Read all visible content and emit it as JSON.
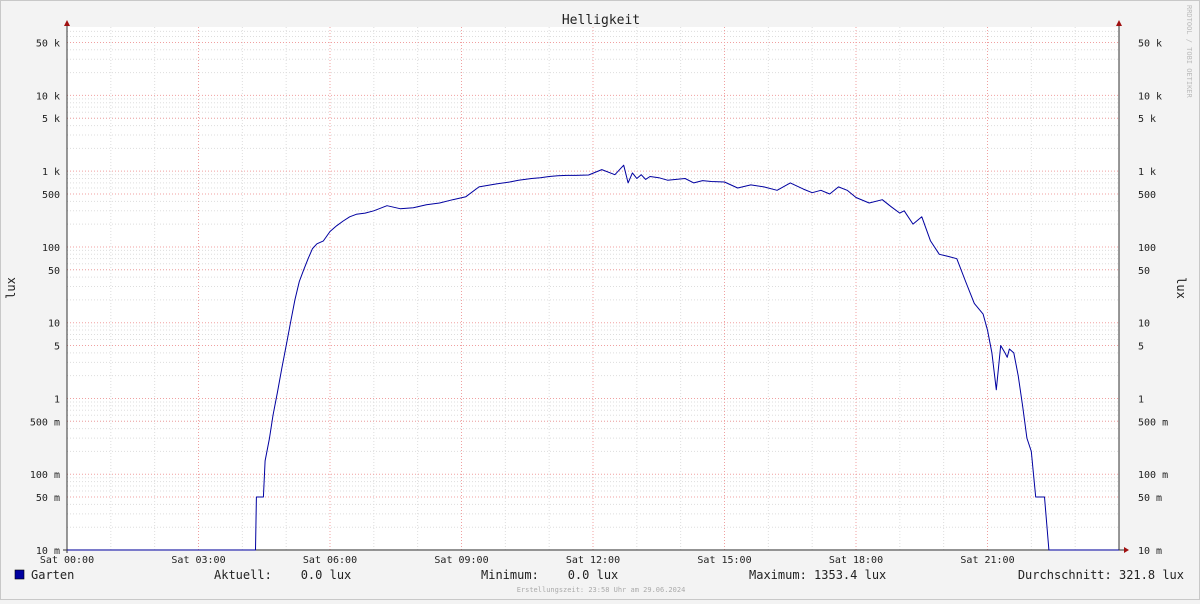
{
  "chart_data": {
    "type": "line",
    "title": "Helligkeit",
    "ylabel": "lux",
    "yscale": "log",
    "ylim": [
      0.01,
      80000
    ],
    "xlim": [
      0,
      24
    ],
    "x_ticks": [
      "Sat 00:00",
      "Sat 03:00",
      "Sat 06:00",
      "Sat 09:00",
      "Sat 12:00",
      "Sat 15:00",
      "Sat 18:00",
      "Sat 21:00"
    ],
    "y_ticks": [
      {
        "value": 0.01,
        "label": "10 m"
      },
      {
        "value": 0.05,
        "label": "50 m"
      },
      {
        "value": 0.1,
        "label": "100 m"
      },
      {
        "value": 0.5,
        "label": "500 m"
      },
      {
        "value": 1,
        "label": "1"
      },
      {
        "value": 5,
        "label": "5"
      },
      {
        "value": 10,
        "label": "10"
      },
      {
        "value": 50,
        "label": "50"
      },
      {
        "value": 100,
        "label": "100"
      },
      {
        "value": 500,
        "label": "500"
      },
      {
        "value": 1000,
        "label": "1 k"
      },
      {
        "value": 5000,
        "label": "5 k"
      },
      {
        "value": 10000,
        "label": "10 k"
      },
      {
        "value": 50000,
        "label": "50 k"
      }
    ],
    "grid": true,
    "series": [
      {
        "name": "Garten",
        "color": "#0000a0",
        "x": [
          0,
          4.3,
          4.32,
          4.48,
          4.52,
          4.62,
          4.7,
          4.8,
          4.9,
          5.0,
          5.1,
          5.2,
          5.3,
          5.4,
          5.5,
          5.6,
          5.7,
          5.85,
          6.0,
          6.15,
          6.3,
          6.45,
          6.6,
          6.8,
          7.0,
          7.3,
          7.6,
          7.9,
          8.2,
          8.5,
          8.8,
          9.1,
          9.4,
          9.8,
          10.1,
          10.3,
          10.6,
          10.8,
          11.0,
          11.2,
          11.4,
          11.6,
          11.9,
          12.2,
          12.5,
          12.7,
          12.8,
          12.9,
          13.0,
          13.1,
          13.2,
          13.3,
          13.5,
          13.7,
          13.9,
          14.1,
          14.3,
          14.5,
          14.7,
          15.0,
          15.3,
          15.6,
          15.9,
          16.2,
          16.5,
          16.8,
          17.0,
          17.2,
          17.4,
          17.6,
          17.8,
          18.0,
          18.3,
          18.6,
          18.8,
          19.0,
          19.1,
          19.3,
          19.5,
          19.7,
          19.9,
          20.1,
          20.3,
          20.5,
          20.7,
          20.9,
          21.0,
          21.1,
          21.2,
          21.3,
          21.4,
          21.45,
          21.5,
          21.6,
          21.7,
          21.8,
          21.9,
          22.0,
          22.1,
          22.2,
          22.3,
          22.4,
          22.5,
          22.6,
          22.7,
          22.75,
          24
        ],
        "values": [
          0.01,
          0.01,
          0.05,
          0.05,
          0.15,
          0.3,
          0.6,
          1.2,
          2.5,
          5,
          10,
          20,
          35,
          50,
          70,
          95,
          110,
          120,
          160,
          190,
          220,
          250,
          270,
          280,
          300,
          350,
          320,
          330,
          360,
          380,
          420,
          460,
          620,
          680,
          720,
          760,
          800,
          820,
          850,
          870,
          880,
          880,
          890,
          1050,
          900,
          1200,
          700,
          950,
          800,
          900,
          780,
          850,
          820,
          760,
          780,
          800,
          700,
          750,
          730,
          720,
          600,
          660,
          620,
          560,
          700,
          580,
          520,
          560,
          500,
          620,
          560,
          450,
          380,
          420,
          340,
          280,
          300,
          200,
          250,
          120,
          80,
          75,
          70,
          35,
          18,
          13,
          8,
          4,
          1.3,
          5,
          4,
          3.5,
          4.5,
          4,
          2,
          0.8,
          0.3,
          0.2,
          0.05,
          0.05,
          0.05,
          0.01,
          0.01,
          0.01,
          0.01,
          0.01,
          0.01
        ]
      }
    ]
  },
  "legend": {
    "series_name": "Garten",
    "swatch_color": "#0000a0",
    "current": "Aktuell:    0.0 lux",
    "minimum": "Minimum:    0.0 lux",
    "maximum": "Maximum: 1353.4 lux",
    "average": "Durchschnitt: 321.8 lux"
  },
  "footer": "Erstellungszeit: 23:58 Uhr am 29.06.2024",
  "vendor_text": "RRDTOOL / TOBI OETIKER",
  "colors": {
    "line": "#0000a0",
    "major_grid": "#f0a0a0",
    "minor_grid": "#dddddd",
    "plot_bg": "#ffffff"
  }
}
